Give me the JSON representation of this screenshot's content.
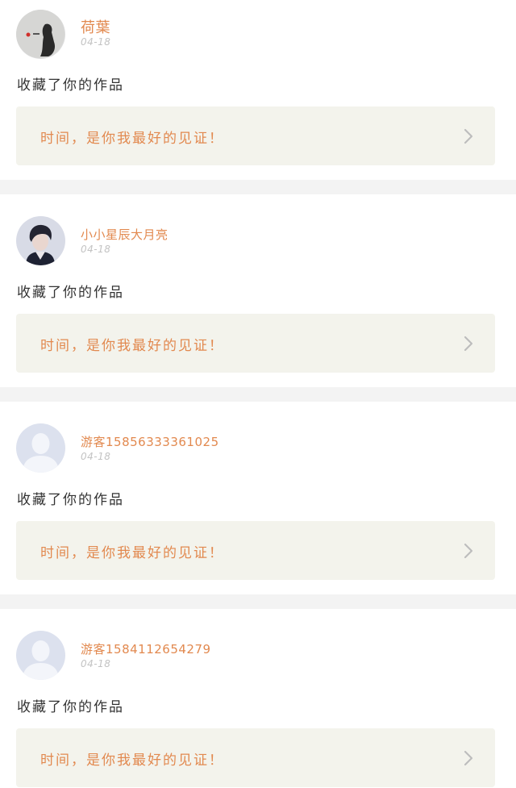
{
  "feed": {
    "items": [
      {
        "username": "荷葉",
        "date": "04-18",
        "action": "收藏了你的作品",
        "quote": "时间，是你我最好的见证！",
        "avatar": "photo-avatar-silhouette"
      },
      {
        "username": "小小星辰大月亮",
        "date": "04-18",
        "action": "收藏了你的作品",
        "quote": "时间，是你我最好的见证！",
        "avatar": "photo-avatar-person"
      },
      {
        "username": "游客15856333361025",
        "date": "04-18",
        "action": "收藏了你的作品",
        "quote": "时间，是你我最好的见证！",
        "avatar": "default-avatar-icon"
      },
      {
        "username": "游客15841126542​79",
        "date": "04-18",
        "action": "收藏了你的作品",
        "quote": "时间，是你我最好的见证！",
        "avatar": "default-avatar-icon"
      }
    ]
  },
  "colors": {
    "accent": "#e2894f",
    "quote_bg": "#f3f3ec",
    "divider": "#f3f3f3",
    "indicator": "#e0457b"
  }
}
